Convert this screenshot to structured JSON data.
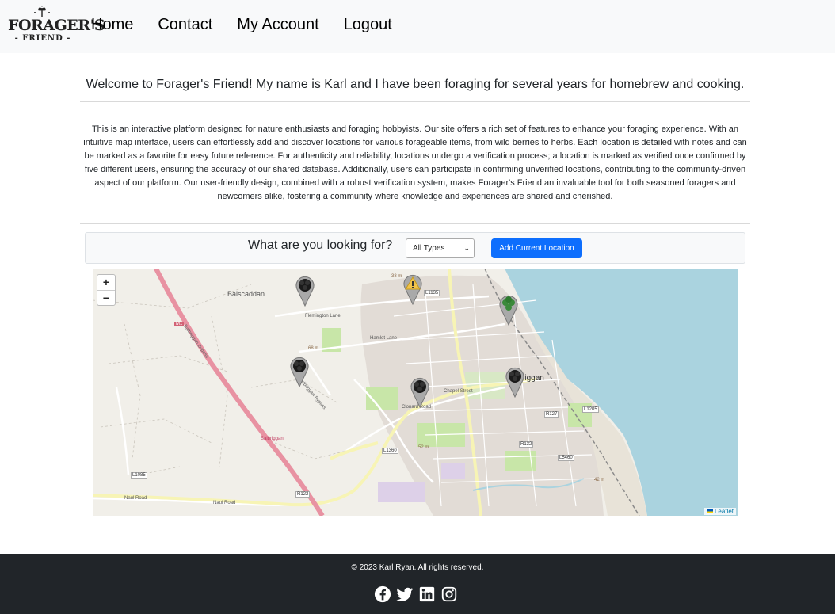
{
  "brand": {
    "name": "FORAGER'S",
    "sub": "- FRIEND -",
    "logo_icon": "sprig-icon"
  },
  "nav": [
    {
      "label": "Home"
    },
    {
      "label": "Contact"
    },
    {
      "label": "My Account"
    },
    {
      "label": "Logout"
    }
  ],
  "welcome": "Welcome to Forager's Friend! My name is Karl and I have been foraging for several years for homebrew and cooking.",
  "about": "This is an interactive platform designed for nature enthusiasts and foraging hobbyists. Our site offers a rich set of features to enhance your foraging experience. With an intuitive map interface, users can effortlessly add and discover locations for various forageable items, from wild berries to herbs. Each location is detailed with notes and can be marked as a favorite for easy future reference. For authenticity and reliability, locations undergo a verification process; a location is marked as verified once confirmed by five different users, ensuring the accuracy of our shared database. Additionally, users can participate in confirming unverified locations, contributing to the community-driven aspect of our platform. Our user-friendly design, combined with a robust verification system, makes Forager's Friend an invaluable tool for both seasoned foragers and newcomers alike, fostering a community where knowledge and experiences are shared and cherished.",
  "search": {
    "label": "What are you looking for?",
    "select_value": "All Types",
    "add_button": "Add Current Location"
  },
  "map": {
    "zoom_in": "+",
    "zoom_out": "−",
    "attribution": "Leaflet",
    "labels": {
      "balscaddan": "Balscaddan",
      "balbriggan": "Balbriggan",
      "balbriggan_bypass": "Balbriggan Bypass",
      "m1": "M1",
      "l1135": "L1135",
      "l1360": "L1360",
      "l1085": "L1085",
      "r122": "R122",
      "r127": "R127",
      "r132": "R132",
      "l1205": "L1205",
      "l5460": "L5460",
      "h38": "38 m",
      "h68": "68 m",
      "h52": "52 m",
      "h42": "42 m",
      "naul_road": "Naul Road",
      "flemington_lane": "Flemington Lane",
      "hamlet_lane": "Hamlet Lane",
      "chapel_street": "Chapel Street",
      "clonard_road": "Clonard Road"
    },
    "markers": [
      {
        "type": "blackberry",
        "icon": "blackberry-marker-icon"
      },
      {
        "type": "warning",
        "icon": "warning-marker-icon"
      },
      {
        "type": "herb",
        "icon": "clover-marker-icon"
      },
      {
        "type": "blackberry",
        "icon": "blackberry-marker-icon"
      },
      {
        "type": "blackberry",
        "icon": "blackberry-marker-icon"
      },
      {
        "type": "blackberry",
        "icon": "blackberry-marker-icon"
      }
    ],
    "colors": {
      "sea": "#aad3df",
      "motorway": "#e892a2",
      "park": "#c8e6a8",
      "land": "#f1efe9"
    }
  },
  "footer": {
    "copyright": "© 2023 Karl Ryan. All rights reserved.",
    "socials": [
      "facebook-icon",
      "twitter-icon",
      "linkedin-icon",
      "instagram-icon"
    ]
  },
  "colors": {
    "primary": "#0d6efd",
    "footer_bg": "#212529",
    "nav_bg": "#f8f9fa"
  }
}
